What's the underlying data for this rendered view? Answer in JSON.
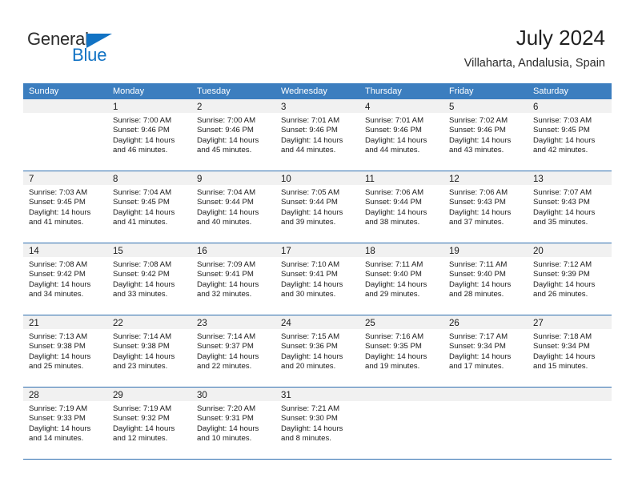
{
  "brand": {
    "word_one": "General",
    "word_two": "Blue",
    "logo_icon": "triangle-icon",
    "accent_color": "#1273c4"
  },
  "header": {
    "title": "July 2024",
    "subtitle": "Villaharta, Andalusia, Spain"
  },
  "theme": {
    "header_blue": "#3c7ebf",
    "rule_blue": "#2f6fb0",
    "daynum_band": "#f1f1f1",
    "text": "#1a1a1a"
  },
  "weekday_headers": [
    "Sunday",
    "Monday",
    "Tuesday",
    "Wednesday",
    "Thursday",
    "Friday",
    "Saturday"
  ],
  "weeks": [
    [
      {
        "day": "",
        "lines": []
      },
      {
        "day": "1",
        "lines": [
          "Sunrise: 7:00 AM",
          "Sunset: 9:46 PM",
          "Daylight: 14 hours",
          "and 46 minutes."
        ]
      },
      {
        "day": "2",
        "lines": [
          "Sunrise: 7:00 AM",
          "Sunset: 9:46 PM",
          "Daylight: 14 hours",
          "and 45 minutes."
        ]
      },
      {
        "day": "3",
        "lines": [
          "Sunrise: 7:01 AM",
          "Sunset: 9:46 PM",
          "Daylight: 14 hours",
          "and 44 minutes."
        ]
      },
      {
        "day": "4",
        "lines": [
          "Sunrise: 7:01 AM",
          "Sunset: 9:46 PM",
          "Daylight: 14 hours",
          "and 44 minutes."
        ]
      },
      {
        "day": "5",
        "lines": [
          "Sunrise: 7:02 AM",
          "Sunset: 9:46 PM",
          "Daylight: 14 hours",
          "and 43 minutes."
        ]
      },
      {
        "day": "6",
        "lines": [
          "Sunrise: 7:03 AM",
          "Sunset: 9:45 PM",
          "Daylight: 14 hours",
          "and 42 minutes."
        ]
      }
    ],
    [
      {
        "day": "7",
        "lines": [
          "Sunrise: 7:03 AM",
          "Sunset: 9:45 PM",
          "Daylight: 14 hours",
          "and 41 minutes."
        ]
      },
      {
        "day": "8",
        "lines": [
          "Sunrise: 7:04 AM",
          "Sunset: 9:45 PM",
          "Daylight: 14 hours",
          "and 41 minutes."
        ]
      },
      {
        "day": "9",
        "lines": [
          "Sunrise: 7:04 AM",
          "Sunset: 9:44 PM",
          "Daylight: 14 hours",
          "and 40 minutes."
        ]
      },
      {
        "day": "10",
        "lines": [
          "Sunrise: 7:05 AM",
          "Sunset: 9:44 PM",
          "Daylight: 14 hours",
          "and 39 minutes."
        ]
      },
      {
        "day": "11",
        "lines": [
          "Sunrise: 7:06 AM",
          "Sunset: 9:44 PM",
          "Daylight: 14 hours",
          "and 38 minutes."
        ]
      },
      {
        "day": "12",
        "lines": [
          "Sunrise: 7:06 AM",
          "Sunset: 9:43 PM",
          "Daylight: 14 hours",
          "and 37 minutes."
        ]
      },
      {
        "day": "13",
        "lines": [
          "Sunrise: 7:07 AM",
          "Sunset: 9:43 PM",
          "Daylight: 14 hours",
          "and 35 minutes."
        ]
      }
    ],
    [
      {
        "day": "14",
        "lines": [
          "Sunrise: 7:08 AM",
          "Sunset: 9:42 PM",
          "Daylight: 14 hours",
          "and 34 minutes."
        ]
      },
      {
        "day": "15",
        "lines": [
          "Sunrise: 7:08 AM",
          "Sunset: 9:42 PM",
          "Daylight: 14 hours",
          "and 33 minutes."
        ]
      },
      {
        "day": "16",
        "lines": [
          "Sunrise: 7:09 AM",
          "Sunset: 9:41 PM",
          "Daylight: 14 hours",
          "and 32 minutes."
        ]
      },
      {
        "day": "17",
        "lines": [
          "Sunrise: 7:10 AM",
          "Sunset: 9:41 PM",
          "Daylight: 14 hours",
          "and 30 minutes."
        ]
      },
      {
        "day": "18",
        "lines": [
          "Sunrise: 7:11 AM",
          "Sunset: 9:40 PM",
          "Daylight: 14 hours",
          "and 29 minutes."
        ]
      },
      {
        "day": "19",
        "lines": [
          "Sunrise: 7:11 AM",
          "Sunset: 9:40 PM",
          "Daylight: 14 hours",
          "and 28 minutes."
        ]
      },
      {
        "day": "20",
        "lines": [
          "Sunrise: 7:12 AM",
          "Sunset: 9:39 PM",
          "Daylight: 14 hours",
          "and 26 minutes."
        ]
      }
    ],
    [
      {
        "day": "21",
        "lines": [
          "Sunrise: 7:13 AM",
          "Sunset: 9:38 PM",
          "Daylight: 14 hours",
          "and 25 minutes."
        ]
      },
      {
        "day": "22",
        "lines": [
          "Sunrise: 7:14 AM",
          "Sunset: 9:38 PM",
          "Daylight: 14 hours",
          "and 23 minutes."
        ]
      },
      {
        "day": "23",
        "lines": [
          "Sunrise: 7:14 AM",
          "Sunset: 9:37 PM",
          "Daylight: 14 hours",
          "and 22 minutes."
        ]
      },
      {
        "day": "24",
        "lines": [
          "Sunrise: 7:15 AM",
          "Sunset: 9:36 PM",
          "Daylight: 14 hours",
          "and 20 minutes."
        ]
      },
      {
        "day": "25",
        "lines": [
          "Sunrise: 7:16 AM",
          "Sunset: 9:35 PM",
          "Daylight: 14 hours",
          "and 19 minutes."
        ]
      },
      {
        "day": "26",
        "lines": [
          "Sunrise: 7:17 AM",
          "Sunset: 9:34 PM",
          "Daylight: 14 hours",
          "and 17 minutes."
        ]
      },
      {
        "day": "27",
        "lines": [
          "Sunrise: 7:18 AM",
          "Sunset: 9:34 PM",
          "Daylight: 14 hours",
          "and 15 minutes."
        ]
      }
    ],
    [
      {
        "day": "28",
        "lines": [
          "Sunrise: 7:19 AM",
          "Sunset: 9:33 PM",
          "Daylight: 14 hours",
          "and 14 minutes."
        ]
      },
      {
        "day": "29",
        "lines": [
          "Sunrise: 7:19 AM",
          "Sunset: 9:32 PM",
          "Daylight: 14 hours",
          "and 12 minutes."
        ]
      },
      {
        "day": "30",
        "lines": [
          "Sunrise: 7:20 AM",
          "Sunset: 9:31 PM",
          "Daylight: 14 hours",
          "and 10 minutes."
        ]
      },
      {
        "day": "31",
        "lines": [
          "Sunrise: 7:21 AM",
          "Sunset: 9:30 PM",
          "Daylight: 14 hours",
          "and 8 minutes."
        ]
      },
      {
        "day": "",
        "lines": []
      },
      {
        "day": "",
        "lines": []
      },
      {
        "day": "",
        "lines": []
      }
    ]
  ]
}
